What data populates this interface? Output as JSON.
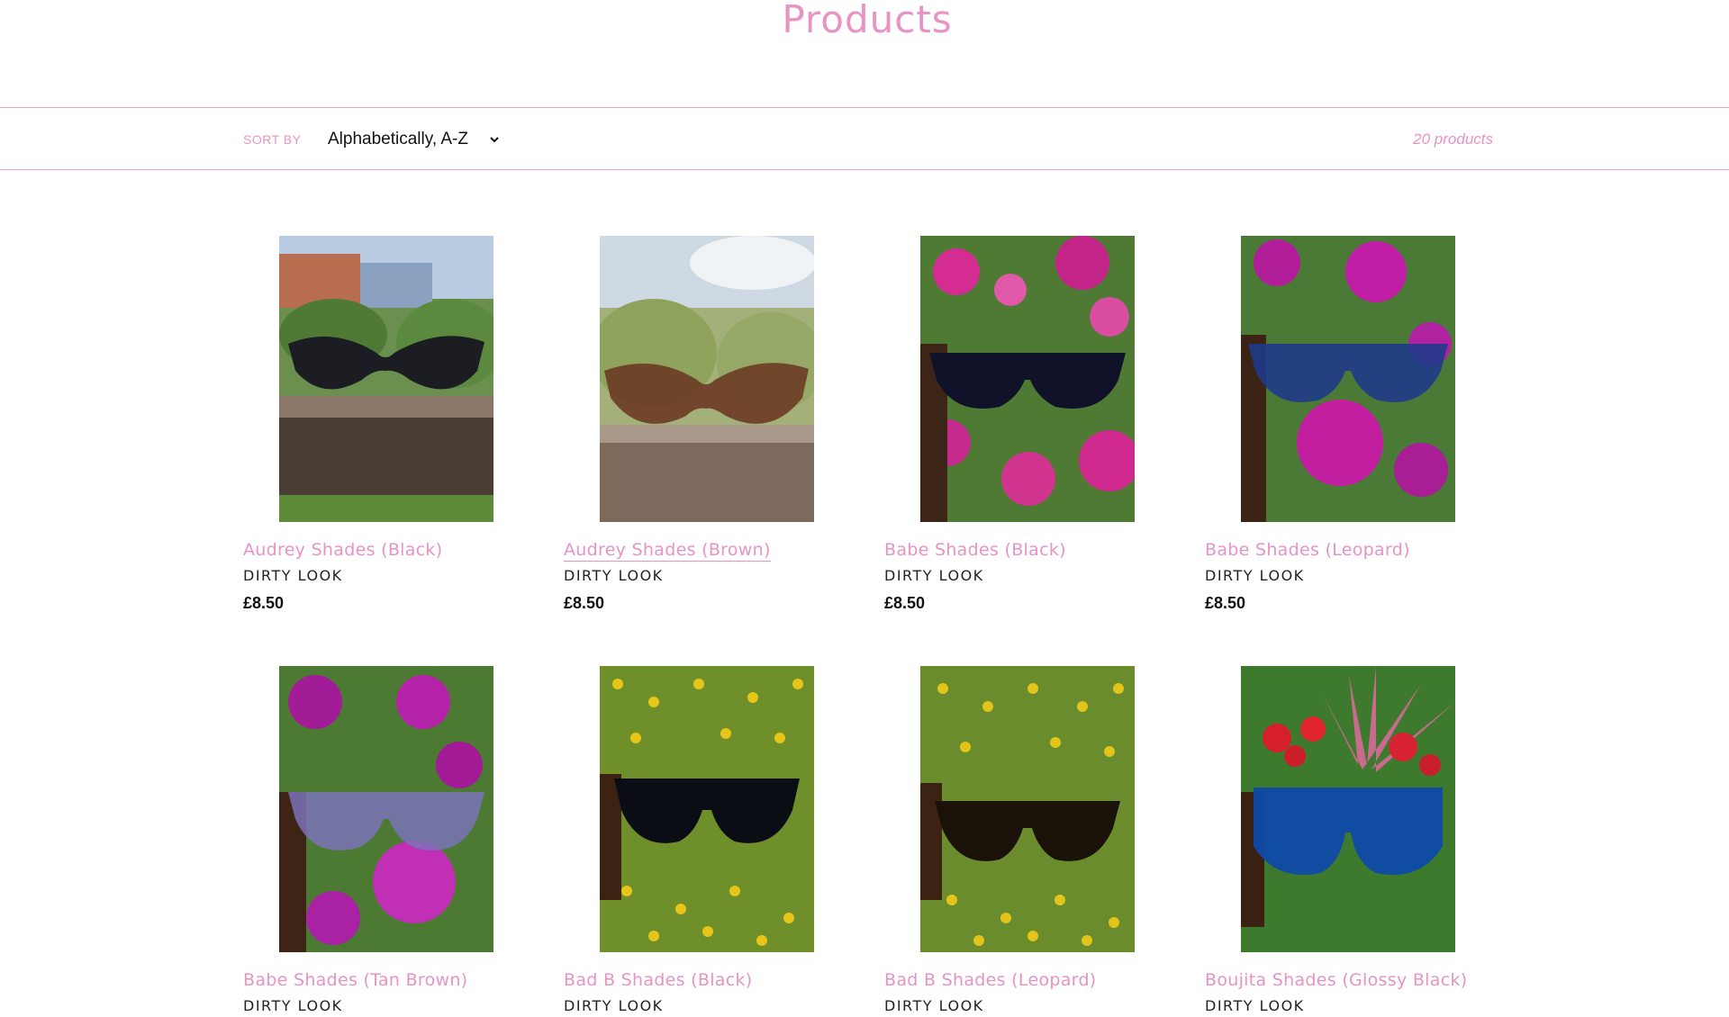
{
  "page": {
    "title": "Products"
  },
  "filters": {
    "sort_label": "SORT BY",
    "sort_value": "Alphabetically, A-Z",
    "product_count": "20 products"
  },
  "products": [
    {
      "title": "Audrey Shades (Black)",
      "vendor": "DIRTY LOOK",
      "price": "£8.50",
      "image": "audrey-black"
    },
    {
      "title": "Audrey Shades (Brown)",
      "vendor": "DIRTY LOOK",
      "price": "£8.50",
      "image": "audrey-brown"
    },
    {
      "title": "Babe Shades (Black)",
      "vendor": "DIRTY LOOK",
      "price": "£8.50",
      "image": "babe-black"
    },
    {
      "title": "Babe Shades (Leopard)",
      "vendor": "DIRTY LOOK",
      "price": "£8.50",
      "image": "babe-leopard"
    },
    {
      "title": "Babe Shades (Tan Brown)",
      "vendor": "DIRTY LOOK",
      "price": "",
      "image": "babe-tan"
    },
    {
      "title": "Bad B Shades (Black)",
      "vendor": "DIRTY LOOK",
      "price": "",
      "image": "badb-black"
    },
    {
      "title": "Bad B Shades (Leopard)",
      "vendor": "DIRTY LOOK",
      "price": "",
      "image": "badb-leopard"
    },
    {
      "title": "Boujita Shades (Glossy Black)",
      "vendor": "DIRTY LOOK",
      "price": "",
      "image": "boujita-black"
    }
  ],
  "colors": {
    "accent": "#e793c4",
    "divider": "#e4a7c9",
    "text": "#111111"
  }
}
